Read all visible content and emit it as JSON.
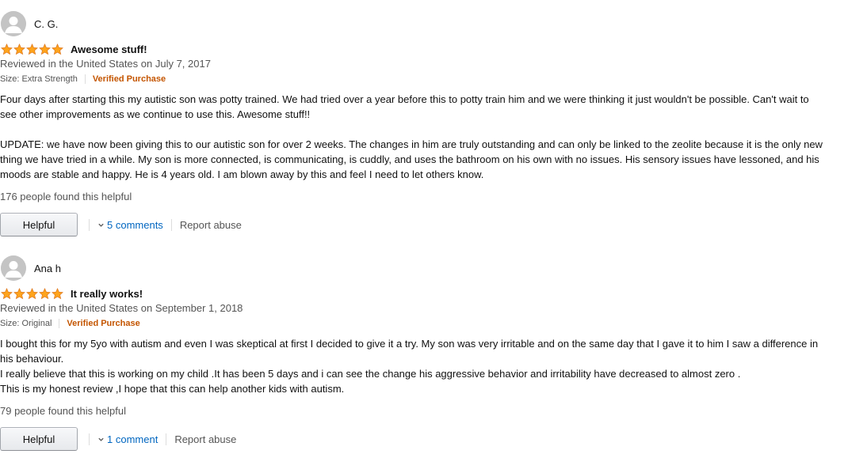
{
  "reviews": [
    {
      "profile_name": "C. G.",
      "rating": 5,
      "title": "Awesome stuff!",
      "date_line": "Reviewed in the United States on July 7, 2017",
      "format": "Size: Extra Strength",
      "verified": "Verified Purchase",
      "body": [
        "Four days after starting this my autistic son was potty trained. We had tried over a year before this to potty train him and we were thinking it just wouldn't be possible. Can't wait to see other improvements as we continue to use this. Awesome stuff!!",
        "UPDATE: we have now been giving this to our autistic son for over 2 weeks. The changes in him are truly outstanding and can only be linked to the zeolite because it is the only new thing we have tried in a while. My son is more connected, is communicating, is cuddly, and uses the bathroom on his own with no issues. His sensory issues have lessoned, and his moods are stable and happy. He is 4 years old. I am blown away by this and feel I need to let others know."
      ],
      "helpful_count": "176 people found this helpful",
      "helpful_button": "Helpful",
      "comments": "5 comments",
      "report": "Report abuse"
    },
    {
      "profile_name": "Ana h",
      "rating": 5,
      "title": "It really works!",
      "date_line": "Reviewed in the United States on September 1, 2018",
      "format": "Size: Original",
      "verified": "Verified Purchase",
      "body": [
        "I bought this for my 5yo with autism and even I was skeptical at first I decided to give it a try. My son was very irritable and on the same day that I gave it to him I saw a difference in his behaviour.",
        "I really believe that this is working on my child .It has been 5 days and i can see the change his aggressive behavior and irritability have decreased to almost zero .",
        "This is my honest review ,I hope that this can help another kids with autism."
      ],
      "helpful_count": "79 people found this helpful",
      "helpful_button": "Helpful",
      "comments": "1 comment",
      "report": "Report abuse"
    }
  ],
  "colors": {
    "star": "#ffa41c",
    "star_outline": "#de7921",
    "verified": "#c45500",
    "link": "#0066c0",
    "secondary_text": "#555555"
  }
}
